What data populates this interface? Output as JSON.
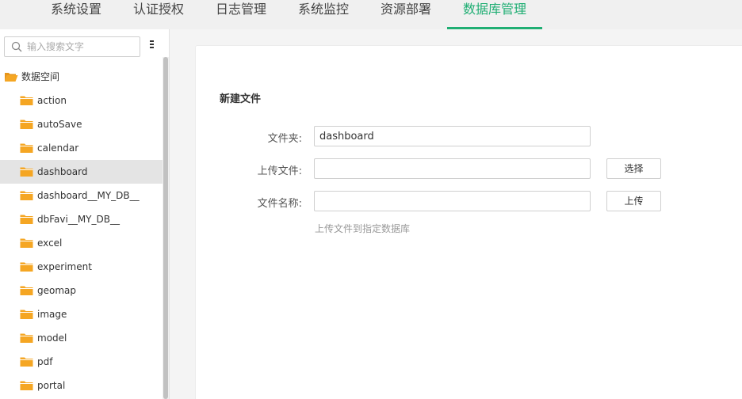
{
  "topnav": {
    "tabs": [
      {
        "label": "系统设置"
      },
      {
        "label": "认证授权"
      },
      {
        "label": "日志管理"
      },
      {
        "label": "系统监控"
      },
      {
        "label": "资源部署"
      },
      {
        "label": "数据库管理"
      }
    ],
    "active_tab": "数据库管理"
  },
  "sidebar": {
    "search": {
      "placeholder": "输入搜索文字",
      "value": ""
    },
    "tree": {
      "root": {
        "label": "数据空间"
      },
      "items": [
        {
          "label": "action"
        },
        {
          "label": "autoSave"
        },
        {
          "label": "calendar"
        },
        {
          "label": "dashboard"
        },
        {
          "label": "dashboard__MY_DB__"
        },
        {
          "label": "dbFavi__MY_DB__"
        },
        {
          "label": "excel"
        },
        {
          "label": "experiment"
        },
        {
          "label": "geomap"
        },
        {
          "label": "image"
        },
        {
          "label": "model"
        },
        {
          "label": "pdf"
        },
        {
          "label": "portal"
        }
      ],
      "selected": "dashboard"
    }
  },
  "form": {
    "title": "新建文件",
    "folder_label": "文件夹:",
    "folder_value": "dashboard",
    "upload_label": "上传文件:",
    "upload_value": "",
    "filename_label": "文件名称:",
    "filename_value": "",
    "select_button": "选择",
    "upload_button": "上传",
    "hint": "上传文件到指定数据库"
  },
  "colors": {
    "accent": "#1fae73",
    "folder": "#f5a623",
    "selected_row": "#e4e4e4"
  }
}
